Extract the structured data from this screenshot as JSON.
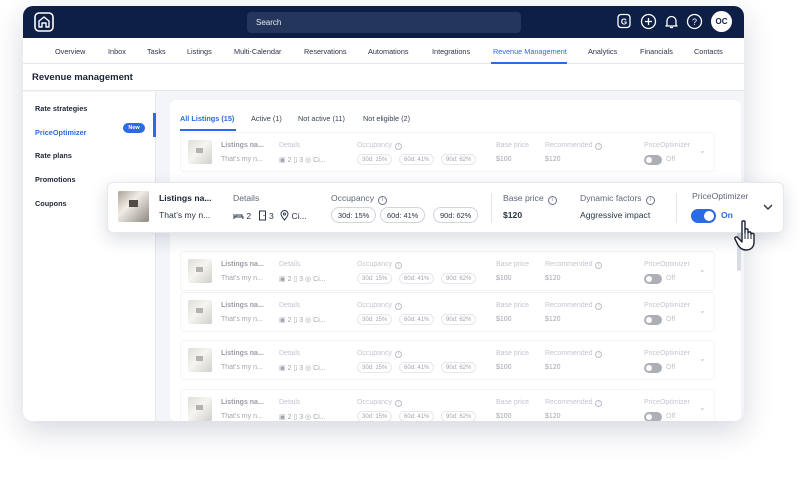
{
  "topbar": {
    "search_placeholder": "Search",
    "avatar_initials": "OC",
    "icons": [
      "home-logo-icon",
      "guidebook-icon",
      "add-icon",
      "bell-icon",
      "help-icon"
    ]
  },
  "nav": {
    "items": [
      "Overview",
      "Inbox",
      "Tasks",
      "Listings",
      "Multi-Calendar",
      "Reservations",
      "Automations",
      "Integrations",
      "Revenue Management",
      "Analytics",
      "Financials",
      "Contacts"
    ],
    "active": "Revenue Management"
  },
  "page": {
    "title": "Revenue management"
  },
  "sidebar": {
    "items": [
      {
        "label": "Rate strategies"
      },
      {
        "label": "PriceOptimizer",
        "badge": "New",
        "active": true
      },
      {
        "label": "Rate plans"
      },
      {
        "label": "Promotions"
      },
      {
        "label": "Coupons"
      }
    ]
  },
  "tabs": [
    "All Listings (15)",
    "Active (1)",
    "Not active (11)",
    "Not eligible (2)"
  ],
  "row": {
    "name": "Listings na...",
    "desc": "That's my n...",
    "details_label": "Details",
    "bedrooms": "2",
    "bathrooms": "3",
    "city": "Ci...",
    "occupancy_label": "Occupancy",
    "occ_30": "30d: 15%",
    "occ_60": "60d: 41%",
    "occ_90": "90d: 62%",
    "base_price_label": "Base price",
    "base_price": "$100",
    "recommended_label": "Recommended",
    "recommended": "$120",
    "optimizer_label": "PriceOptimizer",
    "toggle_off": "Off"
  },
  "card": {
    "name": "Listings na...",
    "desc": "That's my n...",
    "details_label": "Details",
    "bedrooms": "2",
    "bathrooms": "3",
    "city": "Ci...",
    "occupancy_label": "Occupancy",
    "occ_30_label": "30d:",
    "occ_30": "15%",
    "occ_60_label": "60d:",
    "occ_60": "41%",
    "occ_90_label": "90d:",
    "occ_90": "62%",
    "base_price_label": "Base price",
    "base_price": "$120",
    "dynamic_label": "Dynamic factors",
    "dynamic_value": "Aggressive impact",
    "optimizer_label": "PriceOptimizer",
    "toggle_on": "On"
  },
  "colors": {
    "brand_navy": "#0d1f45",
    "accent_blue": "#2a6be6"
  }
}
